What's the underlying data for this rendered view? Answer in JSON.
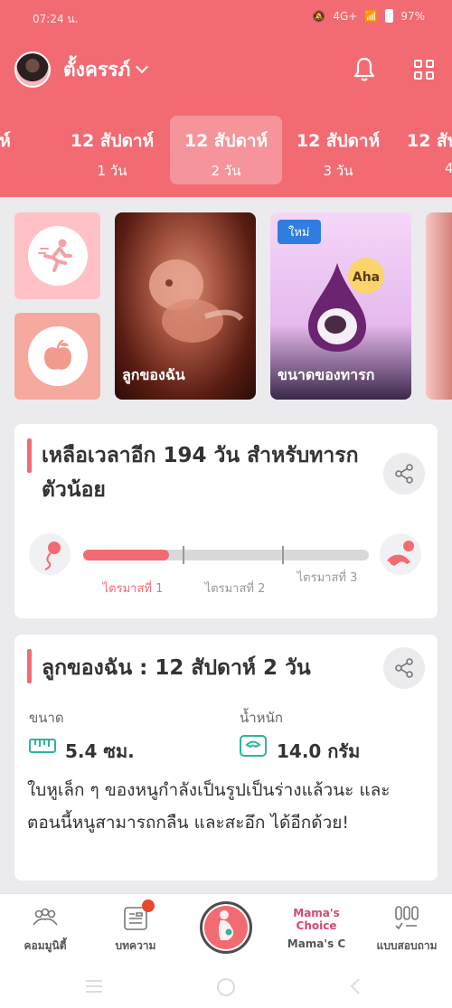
{
  "status_bar": {
    "time": "07:24 น.",
    "network": "4G+",
    "battery": "97%"
  },
  "header": {
    "profile_name": "ตั้งครรภ์",
    "weeks": [
      {
        "week": "ปดาห์",
        "day": ""
      },
      {
        "week": "12 สัปดาห์",
        "day": "1 วัน"
      },
      {
        "week": "12 สัปดาห์",
        "day": "2 วัน",
        "active": true
      },
      {
        "week": "12 สัปดาห์",
        "day": "3 วัน"
      },
      {
        "week": "12 สัป",
        "day": "4"
      }
    ]
  },
  "cards": {
    "my_baby": "ลูกของฉัน",
    "baby_size": "ขนาดของทารก",
    "new_tag": "ใหม่",
    "aha": "Aha"
  },
  "countdown": {
    "title": "เหลือเวลาอีก 194 วัน สำหรับทารกตัวน้อย",
    "progress": 0.3,
    "trimesters": [
      "ไตรมาสที่ 1",
      "ไตรมาสที่ 2",
      "ไตรมาสที่ 3"
    ]
  },
  "baby_info": {
    "title": "ลูกของฉัน : 12 สัปดาห์ 2  วัน",
    "size_label": "ขนาด",
    "size_value": "5.4 ซม.",
    "weight_label": "น้ำหนัก",
    "weight_value": "14.0 กรัม",
    "description": "ใบหูเล็ก ๆ ของหนูกำลังเป็นรูปเป็นร่างแล้วนะ และตอนนี้หนูสามารถกลืน และสะอึก ได้อีกด้วย!"
  },
  "bottom_nav": {
    "community": "คอมมูนิตี้",
    "articles": "บทความ",
    "mamas_choice_logo": "Mama's Choice",
    "mamas_choice": "Mama's C",
    "quiz": "แบบสอบถาม"
  },
  "colors": {
    "accent": "#f26b73",
    "tile_pink": "#ffc1c6",
    "new_blue": "#2f7de1"
  }
}
